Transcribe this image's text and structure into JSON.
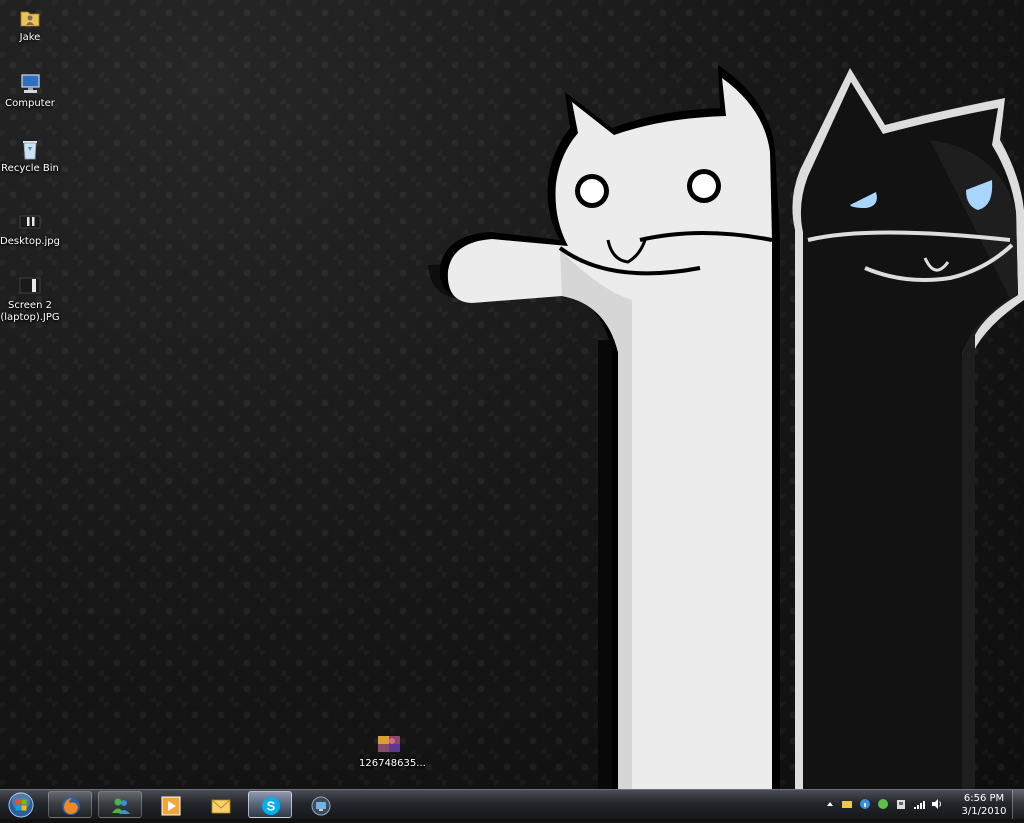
{
  "desktop": {
    "icons": [
      {
        "label": "Jake",
        "icon": "user-folder-icon"
      },
      {
        "label": "Computer",
        "icon": "computer-icon"
      },
      {
        "label": "Recycle Bin",
        "icon": "recycle-bin-icon"
      },
      {
        "label": "Desktop.jpg",
        "icon": "image-file-icon"
      },
      {
        "label": "Screen 2 (laptop).JPG",
        "icon": "image-file-icon"
      },
      {
        "label": "126748635...",
        "icon": "image-file-icon"
      }
    ]
  },
  "taskbar": {
    "start": {
      "icon": "windows-orb-icon"
    },
    "pinned": [
      {
        "icon": "firefox-icon",
        "state": "open"
      },
      {
        "icon": "messenger-icon",
        "state": "open"
      },
      {
        "icon": "media-player-icon",
        "state": "pinned"
      },
      {
        "icon": "mail-icon",
        "state": "pinned"
      },
      {
        "icon": "skype-icon",
        "state": "active"
      },
      {
        "icon": "remote-desktop-icon",
        "state": "pinned"
      }
    ],
    "tray": {
      "icons": [
        "chevron-up-icon",
        "notification-icon",
        "info-icon",
        "green-app-icon",
        "action-center-icon",
        "network-signal-icon",
        "volume-icon"
      ]
    },
    "clock": {
      "time": "6:56 PM",
      "date": "3/1/2010"
    }
  },
  "colors": {
    "wallpaper_bg": "#161616",
    "white_cat": "#ececec",
    "black_cat": "#121212",
    "cat_eyes": "#a9d6ff",
    "taskbar": "#23262b"
  }
}
